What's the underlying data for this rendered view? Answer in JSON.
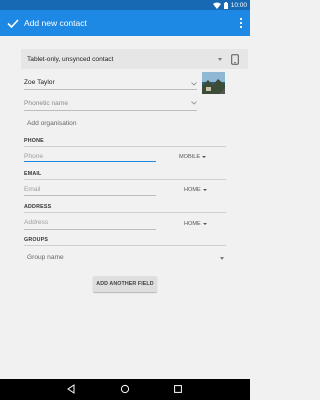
{
  "status": {
    "time": "10:00"
  },
  "appbar": {
    "title": "Add new contact"
  },
  "account": {
    "label": "Tablet-only, unsynced contact"
  },
  "name": {
    "value": "Zoe Taylor"
  },
  "phonetic": {
    "placeholder": "Phonetic name"
  },
  "organisation": {
    "label": "Add organisation"
  },
  "phone": {
    "section": "PHONE",
    "placeholder": "Phone",
    "type": "MOBILE"
  },
  "email": {
    "section": "EMAIL",
    "placeholder": "Email",
    "type": "HOME"
  },
  "address": {
    "section": "ADDRESS",
    "placeholder": "Address",
    "type": "HOME"
  },
  "groups": {
    "section": "GROUPS",
    "value": "Group name"
  },
  "add_field": {
    "label": "ADD ANOTHER FIELD"
  },
  "colors": {
    "statusbar": "#1769b4",
    "appbar": "#1e88e5",
    "background": "#f1f1f1",
    "accent": "#1e88e5"
  }
}
